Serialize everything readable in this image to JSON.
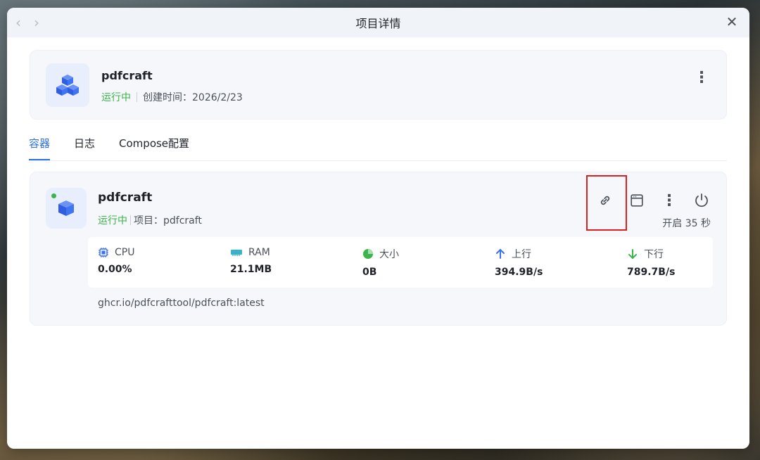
{
  "window": {
    "title": "项目详情",
    "back_icon": "chevron-left-icon",
    "forward_icon": "chevron-right-icon",
    "close_icon": "close-icon"
  },
  "project": {
    "name": "pdfcraft",
    "status": "运行中",
    "created_label": "创建时间：2026/2/23",
    "icon": "cubes-icon",
    "status_color": "#3cb44b"
  },
  "tabs": [
    {
      "label": "容器",
      "active": true
    },
    {
      "label": "日志",
      "active": false
    },
    {
      "label": "Compose配置",
      "active": false
    }
  ],
  "container": {
    "name": "pdfcraft",
    "status": "运行中",
    "project_label": "项目：pdfcraft",
    "uptime": "开启 35 秒",
    "image": "ghcr.io/pdfcrafttool/pdfcraft:latest",
    "actions": [
      "link-icon",
      "browser-window-icon",
      "more-vertical-icon",
      "power-icon"
    ],
    "stats": [
      {
        "label": "CPU",
        "value": "0.00%",
        "icon": "cpu-icon"
      },
      {
        "label": "RAM",
        "value": "21.1MB",
        "icon": "ram-icon"
      },
      {
        "label": "大小",
        "value": "0B",
        "icon": "pie-chart-icon"
      },
      {
        "label": "上行",
        "value": "394.9B/s",
        "icon": "arrow-up-icon"
      },
      {
        "label": "下行",
        "value": "789.7B/s",
        "icon": "arrow-down-icon"
      }
    ]
  },
  "colors": {
    "accent": "#2f6fec",
    "running": "#3cb44b",
    "highlight": "#e02020"
  }
}
